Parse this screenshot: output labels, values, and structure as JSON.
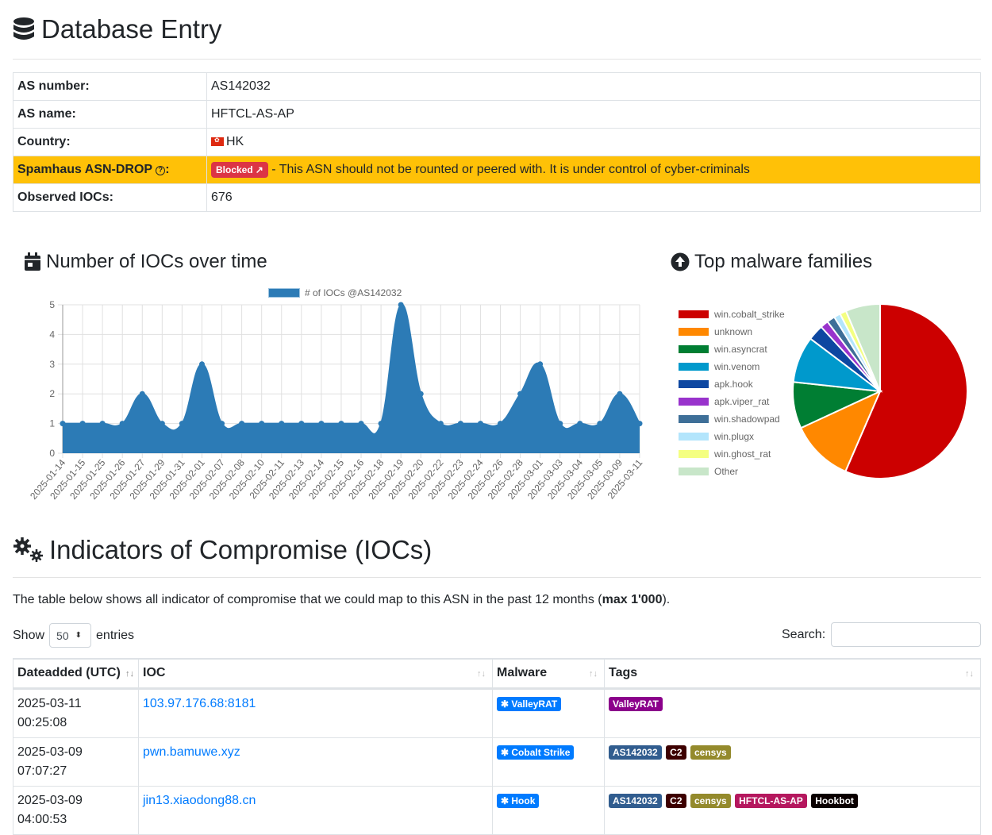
{
  "header": {
    "title": "Database Entry",
    "icon": "database-icon"
  },
  "info": {
    "rows": [
      {
        "label": "AS number:",
        "value": "AS142032"
      },
      {
        "label": "AS name:",
        "value": "HFTCL-AS-AP"
      },
      {
        "label": "Country:",
        "value": "HK",
        "flag": "hong-kong-flag"
      },
      {
        "label": "Spamhaus ASN-DROP",
        "label_suffix": ":",
        "badge": "Blocked",
        "value": "- This ASN should not be rounted or peered with. It is under control of cyber-criminals",
        "highlight": "#ffc107"
      },
      {
        "label": "Observed IOCs:",
        "value": "676"
      }
    ]
  },
  "line_section": {
    "title": "Number of IOCs over time"
  },
  "pie_section": {
    "title": "Top malware families"
  },
  "chart_data": [
    {
      "type": "area",
      "title": "Number of IOCs over time",
      "legend": [
        "# of IOCs @AS142032"
      ],
      "legend_position": "top",
      "xlabel": "",
      "ylabel": "",
      "ylim": [
        0,
        5
      ],
      "yticks": [
        0,
        1,
        2,
        3,
        4,
        5
      ],
      "grid": true,
      "color": "#2c7bb6",
      "x": [
        "2025-01-14",
        "2025-01-15",
        "2025-01-25",
        "2025-01-26",
        "2025-01-27",
        "2025-01-29",
        "2025-01-31",
        "2025-02-01",
        "2025-02-07",
        "2025-02-08",
        "2025-02-10",
        "2025-02-11",
        "2025-02-13",
        "2025-02-14",
        "2025-02-15",
        "2025-02-16",
        "2025-02-18",
        "2025-02-19",
        "2025-02-20",
        "2025-02-22",
        "2025-02-23",
        "2025-02-24",
        "2025-02-26",
        "2025-02-28",
        "2025-03-01",
        "2025-03-03",
        "2025-03-04",
        "2025-03-05",
        "2025-03-09",
        "2025-03-11"
      ],
      "series": [
        {
          "name": "# of IOCs @AS142032",
          "values": [
            1,
            1,
            1,
            1,
            2,
            1,
            1,
            3,
            1,
            1,
            1,
            1,
            1,
            1,
            1,
            1,
            1,
            5,
            2,
            1,
            1,
            1,
            1,
            2,
            3,
            1,
            1,
            1,
            2,
            1
          ]
        }
      ]
    },
    {
      "type": "pie",
      "title": "Top malware families",
      "legend_position": "left",
      "categories": [
        "win.cobalt_strike",
        "unknown",
        "win.asyncrat",
        "win.venom",
        "apk.hook",
        "apk.viper_rat",
        "win.shadowpad",
        "win.plugx",
        "win.ghost_rat",
        "Other"
      ],
      "values": [
        56.5,
        11.6,
        8.6,
        8.6,
        2.9,
        1.5,
        1.5,
        1.2,
        1.2,
        6.4
      ],
      "colors": [
        "#cc0000",
        "#ff8800",
        "#007e33",
        "#0099cc",
        "#0d47a1",
        "#9933cc",
        "#3e6f98",
        "#b3e5fc",
        "#f4ff81",
        "#c8e6c9"
      ]
    }
  ],
  "iocs_section": {
    "title": "Indicators of Compromise (IOCs)",
    "desc_prefix": "The table below shows all indicator of compromise that we could map to this ASN in the past 12 months (",
    "desc_bold": "max 1'000",
    "desc_suffix": ").",
    "show_label": "Show",
    "entries_value": "50",
    "entries_label": "entries",
    "search_label": "Search:",
    "search_value": "",
    "columns": [
      "Dateadded (UTC)",
      "IOC",
      "Malware",
      "Tags"
    ],
    "rows": [
      {
        "date": "2025-03-11",
        "time": "00:25:08",
        "ioc": "103.97.176.68:8181",
        "malware": "ValleyRAT",
        "tags": [
          {
            "t": "ValleyRAT",
            "c": "#8b008b"
          }
        ]
      },
      {
        "date": "2025-03-09",
        "time": "07:07:27",
        "ioc": "pwn.bamuwe.xyz",
        "malware": "Cobalt Strike",
        "tags": [
          {
            "t": "AS142032",
            "c": "#315d8f"
          },
          {
            "t": "C2",
            "c": "#3d0000"
          },
          {
            "t": "censys",
            "c": "#948a2c"
          }
        ]
      },
      {
        "date": "2025-03-09",
        "time": "04:00:53",
        "ioc": "jin13.xiaodong88.cn",
        "malware": "Hook",
        "tags": [
          {
            "t": "AS142032",
            "c": "#315d8f"
          },
          {
            "t": "C2",
            "c": "#3d0000"
          },
          {
            "t": "censys",
            "c": "#948a2c"
          },
          {
            "t": "HFTCL-AS-AP",
            "c": "#b5175e"
          },
          {
            "t": "Hookbot",
            "c": "#0a0000"
          }
        ]
      }
    ]
  }
}
